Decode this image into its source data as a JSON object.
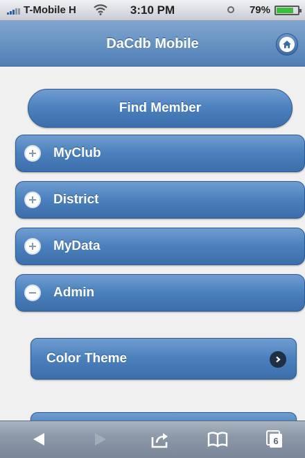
{
  "status_bar": {
    "carrier": "T-Mobile H",
    "time": "3:10 PM",
    "battery": "79%",
    "battery_level": 0.79
  },
  "header": {
    "title": "DaCdb Mobile",
    "home_icon": "home-icon"
  },
  "main": {
    "find_member": "Find Member",
    "sections": [
      {
        "label": "MyClub",
        "state": "collapsed",
        "icon": "plus-circle-icon"
      },
      {
        "label": "District",
        "state": "collapsed",
        "icon": "plus-circle-icon"
      },
      {
        "label": "MyData",
        "state": "collapsed",
        "icon": "plus-circle-icon"
      },
      {
        "label": "Admin",
        "state": "expanded",
        "icon": "minus-circle-icon"
      }
    ],
    "admin_items": [
      {
        "label": "Color Theme",
        "icon": "chevron-right-icon"
      }
    ]
  },
  "toolbar": {
    "tab_count": "6"
  },
  "colors": {
    "accent": "#4b80bd",
    "header": "#5f8bbf",
    "background": "#f0f0f0"
  }
}
